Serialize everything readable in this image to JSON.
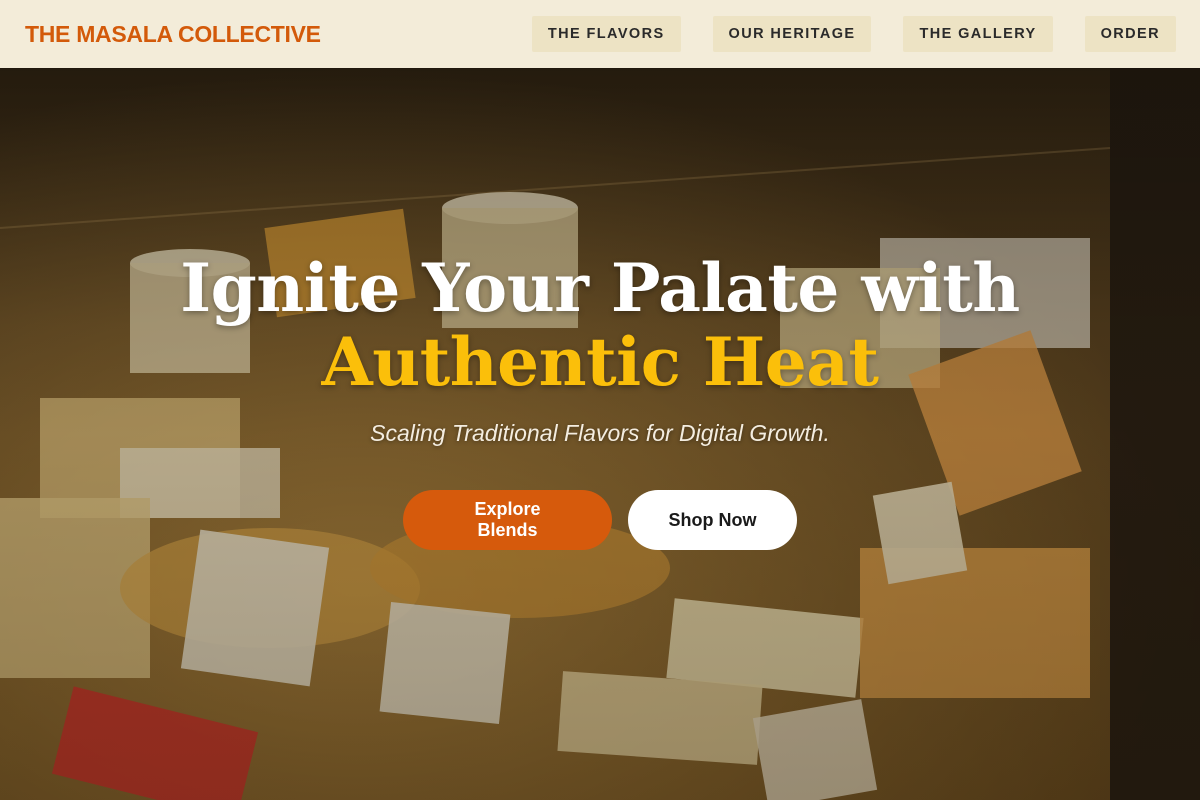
{
  "header": {
    "brand": "THE MASALA COLLECTIVE",
    "nav": [
      {
        "label": "THE FLAVORS"
      },
      {
        "label": "OUR HERITAGE"
      },
      {
        "label": "THE GALLERY"
      },
      {
        "label": "ORDER"
      }
    ]
  },
  "hero": {
    "headline_line1": "Ignite Your Palate with",
    "headline_line2": "Authentic Heat",
    "tagline": "Scaling Traditional Flavors for Digital Growth.",
    "primary_cta": "Explore Blends",
    "secondary_cta": "Shop Now",
    "background_image": "cheese shop display case"
  },
  "colors": {
    "brand": "#d35a0a",
    "accent": "#fbbf0a",
    "header_bg": "#f3ecd9",
    "nav_item_bg": "#ede3c4"
  }
}
